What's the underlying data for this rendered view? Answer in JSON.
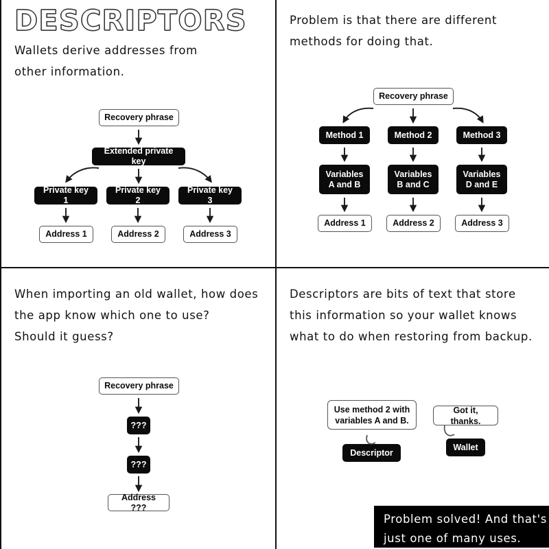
{
  "page": {
    "title": "DESCRIPTORS",
    "background": "#ffffff",
    "ink": "#0b0b0b"
  },
  "panels": {
    "top_left": {
      "heading": "DESCRIPTORS",
      "caption": "Wallets derive addresses from\nother information.",
      "diagram": {
        "root": "Recovery phrase",
        "middle": "Extended private key",
        "keys": [
          "Private key 1",
          "Private key 2",
          "Private key 3"
        ],
        "addresses": [
          "Address 1",
          "Address 2",
          "Address 3"
        ]
      }
    },
    "top_right": {
      "caption": "Problem is that there are different\nmethods for doing that.",
      "diagram": {
        "root": "Recovery phrase",
        "methods": [
          "Method 1",
          "Method 2",
          "Method 3"
        ],
        "variables": [
          "Variables\nA and B",
          "Variables\nB and C",
          "Variables\nD and E"
        ],
        "addresses": [
          "Address 1",
          "Address 2",
          "Address 3"
        ]
      }
    },
    "bottom_left": {
      "caption": "When importing an old wallet, how does\nthe app know which one to use?\nShould it guess?",
      "diagram": {
        "root": "Recovery phrase",
        "unknown_1": "???",
        "unknown_2": "???",
        "address": "Address ???"
      }
    },
    "bottom_right": {
      "caption": "Descriptors are bits of text that store\nthis information so your wallet knows\nwhat to do when restoring from backup.",
      "scene": {
        "descriptor_bubble": "Use method 2 with\nvariables A and B.",
        "descriptor_label": "Descriptor",
        "wallet_bubble": "Got it, thanks.",
        "wallet_label": "Wallet"
      },
      "banner": "Problem solved! And that's\njust one of many uses."
    }
  },
  "colors": {
    "dark_node_bg": "#0b0b0b",
    "dark_node_text": "#ffffff",
    "light_node_bg": "#ffffff",
    "light_node_border": "#555555",
    "banner_bg": "#000000",
    "banner_text": "#ffffff"
  }
}
